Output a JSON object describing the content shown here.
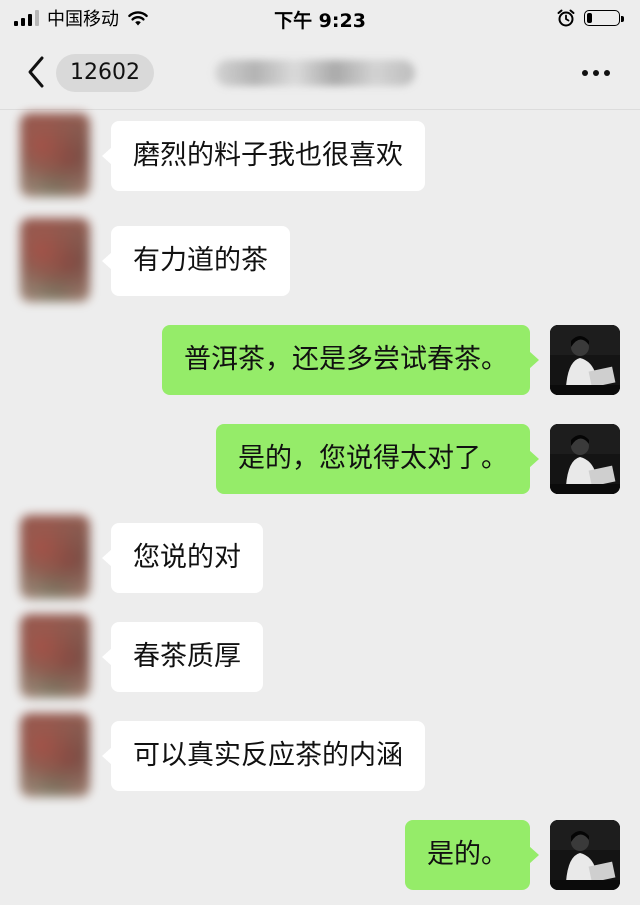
{
  "status_bar": {
    "carrier": "中国移动",
    "time": "下午 9:23",
    "battery_level": 0.15,
    "icons": [
      "signal-icon",
      "wifi-icon",
      "alarm-icon",
      "battery-icon"
    ]
  },
  "nav": {
    "unread_count": "12602",
    "icons": [
      "back-icon",
      "more-icon"
    ]
  },
  "messages": [
    {
      "direction": "in",
      "text": "磨烈的料子我也很喜欢"
    },
    {
      "direction": "in",
      "text": "有力道的茶"
    },
    {
      "direction": "out",
      "text": "普洱茶，还是多尝试春茶。"
    },
    {
      "direction": "out",
      "text": "是的，您说得太对了。"
    },
    {
      "direction": "in",
      "text": "您说的对"
    },
    {
      "direction": "in",
      "text": "春茶质厚"
    },
    {
      "direction": "in",
      "text": "可以真实反应茶的内涵"
    },
    {
      "direction": "out",
      "text": "是的。"
    }
  ],
  "colors": {
    "background": "#ededed",
    "incoming_bubble": "#ffffff",
    "outgoing_bubble": "#95ec69",
    "text": "#111111"
  }
}
